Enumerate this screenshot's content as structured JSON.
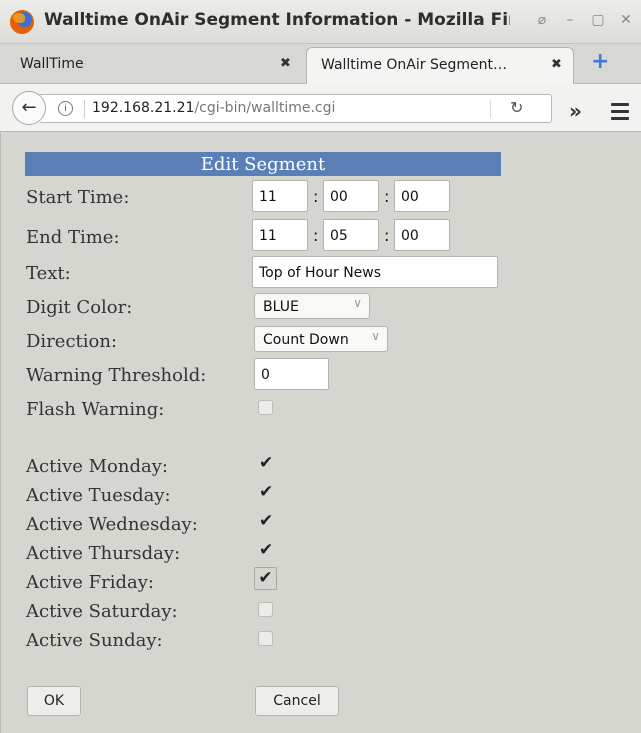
{
  "window": {
    "title": "Walltime OnAir Segment Information - Mozilla Fire",
    "buttons": {
      "restore": "⌀",
      "minimize": "–",
      "maximize": "▢",
      "close": "✕"
    }
  },
  "tabs": [
    {
      "label": "WallTime",
      "close": "✖"
    },
    {
      "label": "Walltime OnAir Segment…",
      "close": "✖"
    }
  ],
  "newtab": "+",
  "nav": {
    "back": "←",
    "info": "i",
    "url_host": "192.168.21.21",
    "url_path": "/cgi-bin/walltime.cgi",
    "reload": "↻",
    "overflow": "»"
  },
  "form": {
    "header": "Edit Segment",
    "start_time": {
      "label": "Start Time:",
      "hh": "11",
      "mm": "00",
      "ss": "00"
    },
    "end_time": {
      "label": "End Time:",
      "hh": "11",
      "mm": "05",
      "ss": "00"
    },
    "colon": ":",
    "text": {
      "label": "Text:",
      "value": "Top of Hour News"
    },
    "digit_color": {
      "label": "Digit Color:",
      "value": "BLUE"
    },
    "direction": {
      "label": "Direction:",
      "value": "Count Down"
    },
    "warning_threshold": {
      "label": "Warning Threshold:",
      "value": "0"
    },
    "flash_warning": {
      "label": "Flash Warning:",
      "checked": false
    },
    "days": [
      {
        "label": "Active Monday:",
        "checked": true
      },
      {
        "label": "Active Tuesday:",
        "checked": true
      },
      {
        "label": "Active Wednesday:",
        "checked": true
      },
      {
        "label": "Active Thursday:",
        "checked": true
      },
      {
        "label": "Active Friday:",
        "checked": true
      },
      {
        "label": "Active Saturday:",
        "checked": false
      },
      {
        "label": "Active Sunday:",
        "checked": false
      }
    ],
    "check_glyph": "✔",
    "chevron": "∨",
    "ok": "OK",
    "cancel": "Cancel"
  }
}
